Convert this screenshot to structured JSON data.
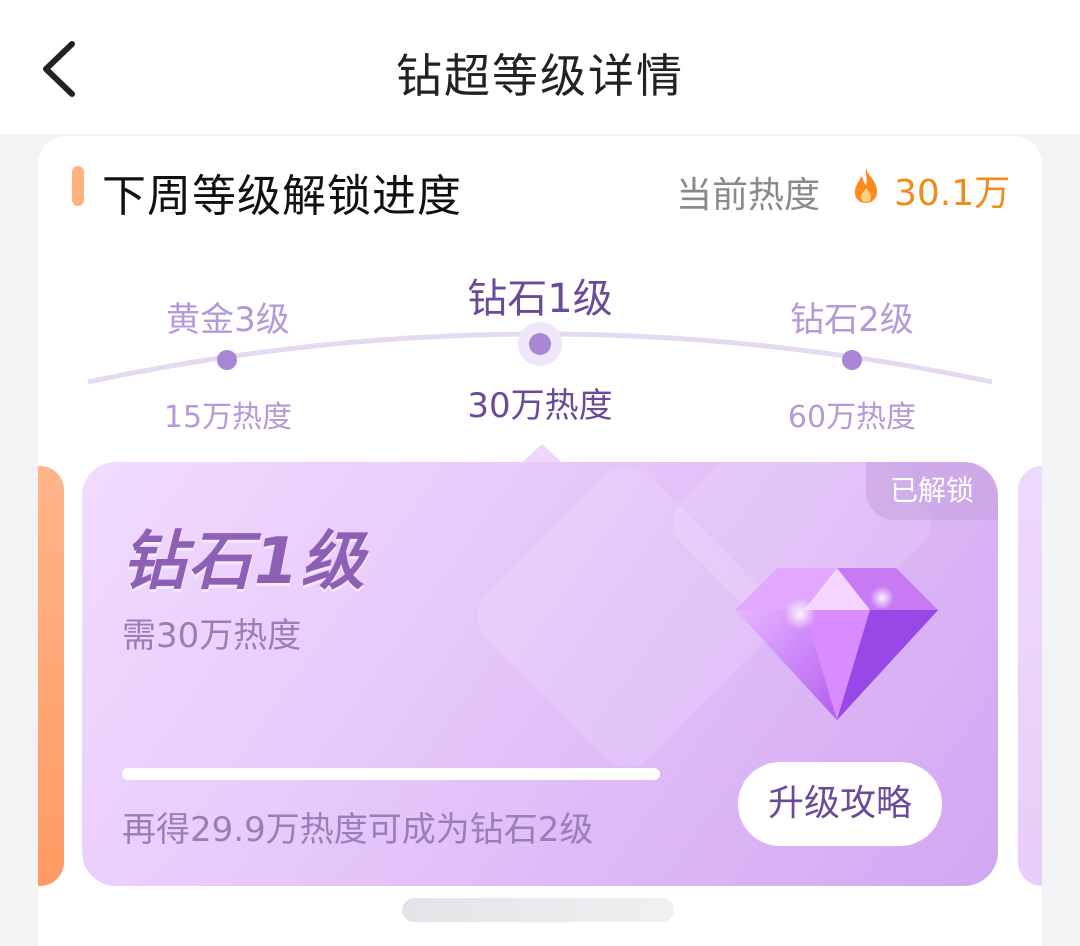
{
  "header": {
    "title": "钻超等级详情"
  },
  "section": {
    "title": "下周等级解锁进度",
    "current_heat_label": "当前热度",
    "current_heat_value": "30.1万"
  },
  "levels": [
    {
      "name": "黄金3级",
      "requirement": "15万热度"
    },
    {
      "name": "钻石1级",
      "requirement": "30万热度"
    },
    {
      "name": "钻石2级",
      "requirement": "60万热度"
    }
  ],
  "active_level_index": 1,
  "level_card": {
    "badge": "已解锁",
    "title": "钻石1级",
    "requirement": "需30万热度",
    "progress": 0.0,
    "hint": "再得29.9万热度可成为钻石2级",
    "guide_button": "升级攻略"
  },
  "colors": {
    "accent_orange": "#f38b1b",
    "purple_text": "#6b4a9a",
    "light_purple": "#b49ad6"
  },
  "icons": [
    "back-chevron-icon",
    "fire-icon",
    "diamond-gem-icon"
  ]
}
